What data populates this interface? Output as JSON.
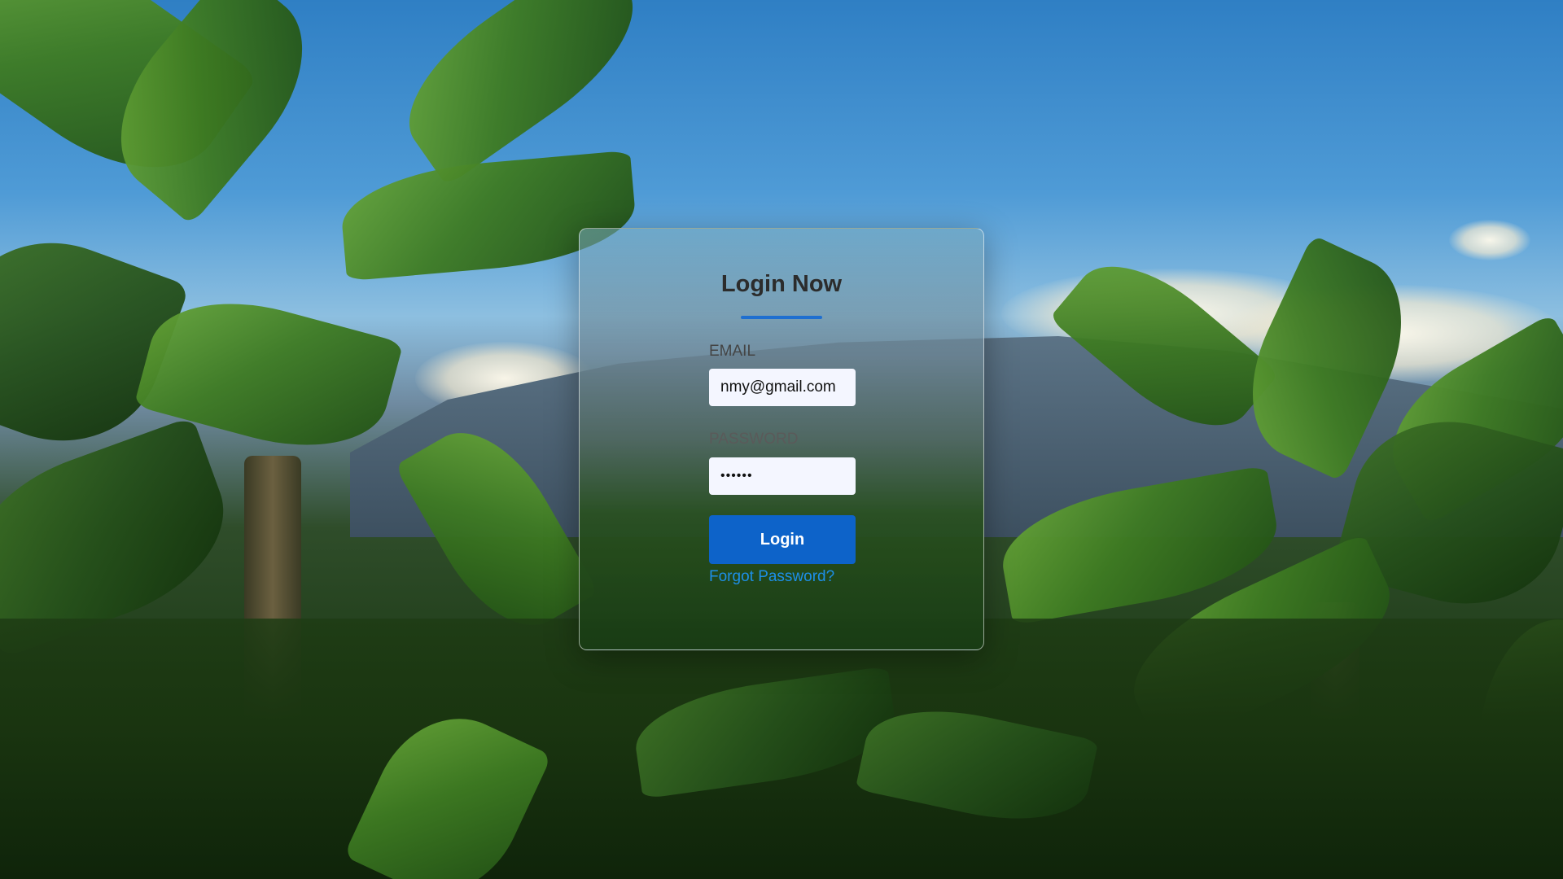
{
  "login": {
    "title": "Login Now",
    "email_label": "EMAIL",
    "email_value": "nmy@gmail.com",
    "password_label": "PASSWORD",
    "password_value": "••••••",
    "submit_label": "Login",
    "forgot_label": "Forgot Password?"
  },
  "colors": {
    "accent": "#0d63c9",
    "underline": "#1f6fd0",
    "link": "#1d8fe8",
    "input_bg": "#f4f6ff",
    "title": "#2c2c2c"
  },
  "background": {
    "icon": "banana-plantation-photo"
  }
}
